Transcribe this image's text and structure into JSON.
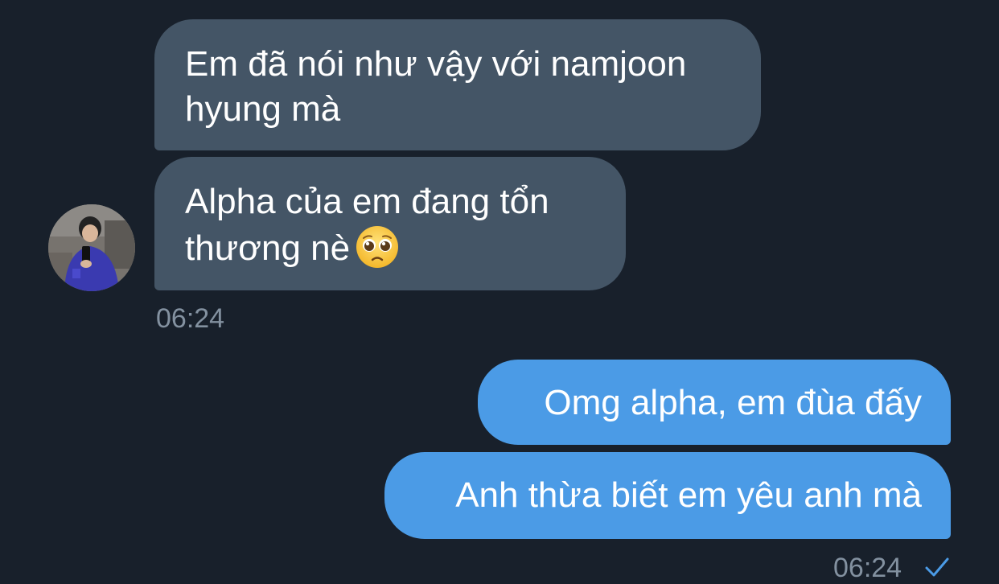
{
  "conversation": {
    "incoming": {
      "messages": [
        {
          "text": "Em đã nói như vậy với namjoon\nhyung mà"
        },
        {
          "text": "Alpha của em đang tổn\nthương nè",
          "emoji": "pleading-face-emoji"
        }
      ],
      "time": "06:24",
      "avatar": "contact-avatar-photo"
    },
    "outgoing": {
      "messages": [
        {
          "text": "Omg alpha, em đùa đấy"
        },
        {
          "text": "Anh thừa biết em yêu anh mà"
        }
      ],
      "time": "06:24",
      "status_icon": "checkmark-icon"
    }
  },
  "colors": {
    "background": "#18202b",
    "incoming_bubble": "#445566",
    "outgoing_bubble": "#4b9be6",
    "timestamp": "#8391a0",
    "checkmark": "#4b9be6"
  }
}
